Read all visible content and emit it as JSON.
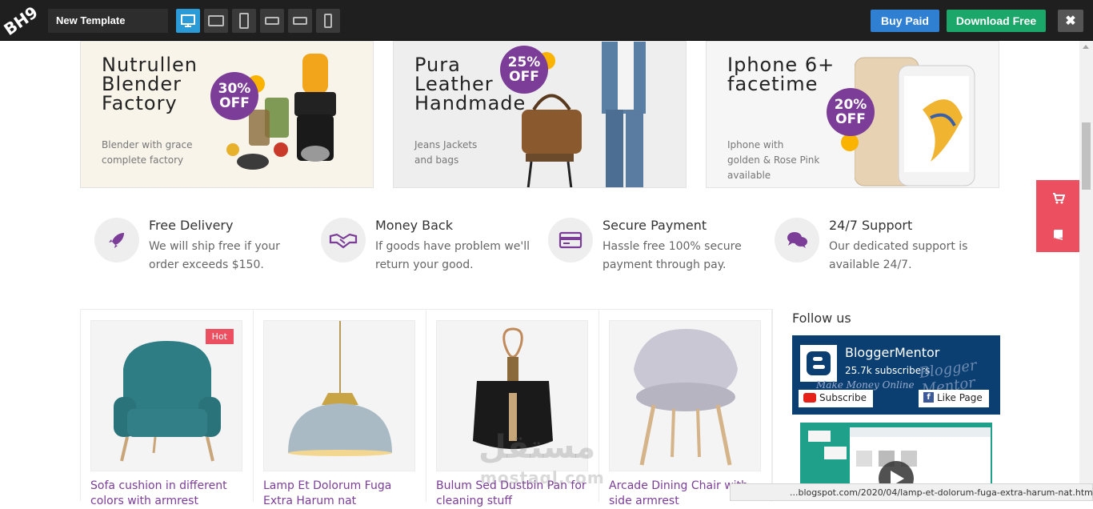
{
  "topbar": {
    "logo_text": "BH9",
    "template_name": "New Template",
    "devices": [
      "desktop-icon",
      "tablet-landscape-icon",
      "tablet-portrait-icon",
      "phone-landscape-icon",
      "small-landscape-icon",
      "phone-portrait-icon"
    ],
    "buy_label": "Buy Paid",
    "download_label": "Download Free",
    "close_label": "✖"
  },
  "banners": [
    {
      "title": "Nutrullen\nBlender\nFactory",
      "desc": "Blender with grace\ncomplete factory",
      "discount": "30%",
      "off": "OFF"
    },
    {
      "title": "Pura\nLeather\nHandmade",
      "desc": "Jeans Jackets\nand bags",
      "discount": "25%",
      "off": "OFF"
    },
    {
      "title": "Iphone 6+\nfacetime",
      "desc": "Iphone with\ngolden & Rose Pink\navailable",
      "discount": "20%",
      "off": "OFF"
    }
  ],
  "features": [
    {
      "title": "Free Delivery",
      "desc": "We will ship free if your\norder exceeds $150.",
      "icon": "rocket-icon"
    },
    {
      "title": "Money Back",
      "desc": "If goods have problem we'll\nreturn your good.",
      "icon": "handshake-icon"
    },
    {
      "title": "Secure Payment",
      "desc": "Hassle free 100% secure\npayment through pay.",
      "icon": "credit-card-icon"
    },
    {
      "title": "24/7 Support",
      "desc": "Our dedicated support is\navailable 24/7.",
      "icon": "chat-icon"
    }
  ],
  "products": [
    {
      "name": "Sofa cushion in different colors with armrest",
      "badge": "Hot"
    },
    {
      "name": "Lamp Et Dolorum Fuga Extra Harum nat",
      "badge": ""
    },
    {
      "name": "Bulum Sed Dustbin Pan for cleaning stuff",
      "badge": ""
    },
    {
      "name": "Arcade Dining Chair with side armrest",
      "badge": ""
    }
  ],
  "sidebar": {
    "follow_title": "Follow us",
    "channel_name": "BloggerMentor",
    "subscribers": "25.7k subscribers",
    "tagline": "Make Money Online",
    "script_text": "Blogger Mentor",
    "subscribe_label": "Subscribe",
    "like_label": "Like Page"
  },
  "status_url": "...blogspot.com/2020/04/lamp-et-dolorum-fuga-extra-harum-nat.html",
  "watermark": {
    "arabic": "مستقل",
    "latin": "mostaql.com"
  },
  "colors": {
    "accent": "#7b3d97",
    "buy": "#2f7fd3",
    "download": "#1aa769",
    "side_buttons": "#ec4f5f",
    "badge_yellow": "#f9b300"
  }
}
